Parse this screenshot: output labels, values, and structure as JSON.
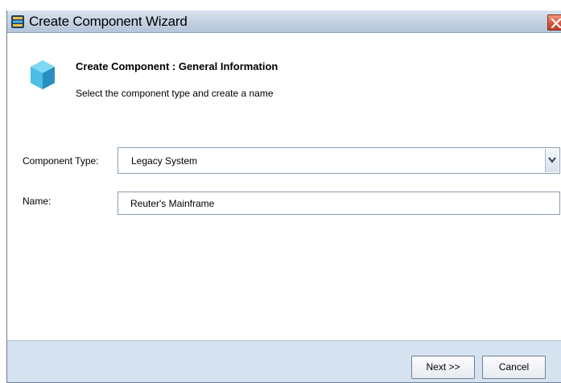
{
  "window": {
    "title": "Create Component Wizard"
  },
  "header": {
    "title": "Create Component : General Information",
    "subtitle": "Select the component type and create a name"
  },
  "form": {
    "component_type_label": "Component Type:",
    "component_type_value": "Legacy System",
    "name_label": "Name:",
    "name_value": "Reuter's Mainframe"
  },
  "footer": {
    "next_label": "Next >>",
    "cancel_label": "Cancel"
  },
  "colors": {
    "cube_light": "#5ec9e8",
    "cube_dark": "#2a8fc0",
    "footer_bg": "#d5e2f0",
    "close_red": "#d5553a"
  }
}
